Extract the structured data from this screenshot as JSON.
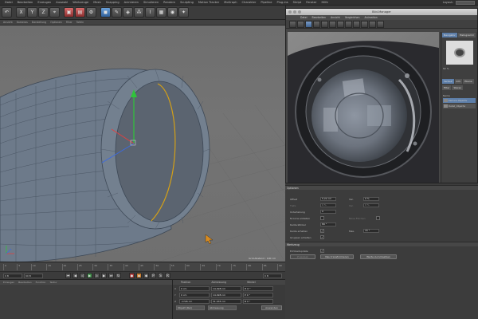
{
  "menubar": {
    "items": [
      "Datei",
      "Bearbeiten",
      "Erzeugen",
      "Auswahl",
      "Werkzeuge",
      "Mesh",
      "Snapping",
      "Animieren",
      "Simulieren",
      "Rendern",
      "Sculpting",
      "Motion Tracker",
      "MoGraph",
      "Charakter",
      "Pipeline",
      "Plug-ins",
      "Skript",
      "Fenster",
      "Hilfe"
    ],
    "layout_label": "Layout:"
  },
  "toolbar": {
    "buttons": [
      "undo",
      "X",
      "Y",
      "Z",
      "coord",
      "render",
      "render-view",
      "render-settings",
      "cube",
      "pen",
      "subdiv",
      "array",
      "deformer",
      "scene",
      "camera",
      "light"
    ]
  },
  "viewport": {
    "header_items": [
      "Ansicht",
      "Kameras",
      "Darstellung",
      "Optionen",
      "Filter",
      "Tafeln"
    ],
    "label": "Grid-Abstand : 100 cm"
  },
  "timeline": {
    "ticks": [
      "0",
      "5",
      "10",
      "15",
      "20",
      "25",
      "30",
      "35",
      "40",
      "45",
      "50",
      "55",
      "60",
      "65",
      "70",
      "75",
      "80",
      "85",
      "90"
    ],
    "start_frame": "0 B",
    "end_frame": "90 B",
    "current_frame": "0 B"
  },
  "materials": {
    "menu": [
      "Erzeugen",
      "Bearbeiten",
      "Funktion",
      "Textur"
    ]
  },
  "coords": {
    "headers": [
      "Position",
      "Abmessung",
      "Winkel"
    ],
    "rows": [
      {
        "axis": "X",
        "pos": "0 cm",
        "size": "14.098 cm",
        "ang": "H 0 °"
      },
      {
        "axis": "Y",
        "pos": "0 cm",
        "size": "14.098 cm",
        "ang": "P 0 °"
      },
      {
        "axis": "Z",
        "pos": "-1726 cm",
        "size": "31.035 cm",
        "ang": "B 0 °"
      }
    ],
    "mode": "Objekt (Rel)",
    "size_mode": "Abmessung",
    "apply": "Anwenden"
  },
  "picture_viewer": {
    "title": "Bild-Manager",
    "menu": [
      "Datei",
      "Bearbeiten",
      "Ansicht",
      "Vergleichen",
      "Animation"
    ],
    "zoom": "82 %",
    "status": "Größe: 4048x3044, RGB (8 Bit), 32.64 MB",
    "side_tabs": [
      "Navigator",
      "Histogramm"
    ],
    "side_zoom": "82 %",
    "history_tabs": [
      "Verlauf",
      "Info",
      "Ebene",
      "Filter",
      "Stereo"
    ],
    "name_header": "Name",
    "list_items": [
      "Kamera Objektiv",
      "Detail_Objektiv"
    ]
  },
  "attributes": {
    "section1": "Optionen",
    "section2": "Werkzeug",
    "rows": [
      {
        "label": "Offset",
        "value": "5.22 cm",
        "label2": "Var.",
        "value2": "0 %"
      },
      {
        "label": "Tiefe",
        "value": "0 %",
        "label2": "Var.",
        "value2": "0 %"
      },
      {
        "label": "Unterteilung",
        "value": "0"
      },
      {
        "label": "N-Gons erstellen",
        "label2": "Neue Flächen"
      },
      {
        "label": "Kante-Winkel",
        "value": "89 °"
      },
      {
        "label": "Kante erhalten",
        "label2": "Max.",
        "value2": "15 °"
      },
      {
        "label": "Gruppen erhalten"
      }
    ],
    "realtime_label": "Echtzeitupdate",
    "buttons": [
      "Zuweisen",
      "Neu transformieren",
      "Werte zurücksetzen"
    ]
  },
  "colors": {
    "accent": "#5d7ea8",
    "selection": "#d4a017",
    "axis_y": "#2fc43a",
    "axis_x": "#e04040",
    "axis_z": "#3c6ae0"
  }
}
